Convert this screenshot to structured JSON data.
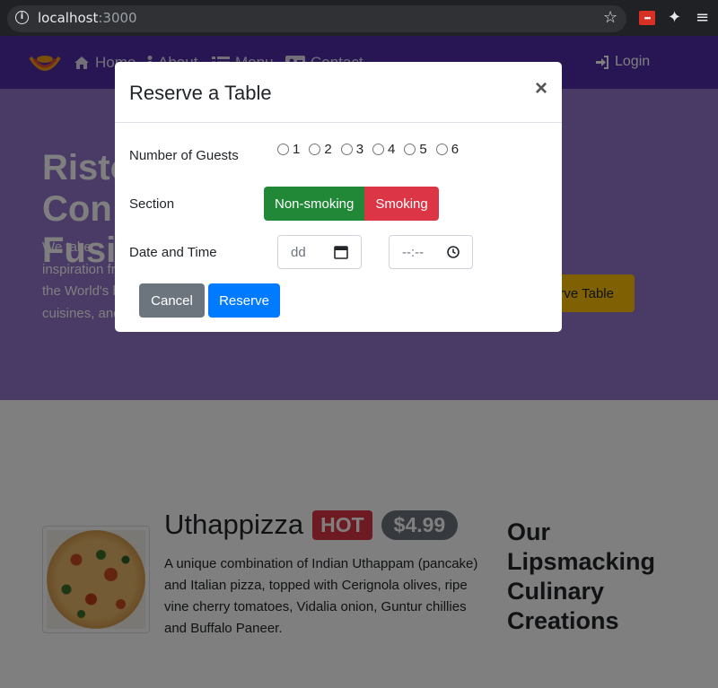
{
  "browser": {
    "url_host": "localhost",
    "url_port": ":3000"
  },
  "navbar": {
    "items": [
      {
        "label": "Home"
      },
      {
        "label": "About"
      },
      {
        "label": "Menu"
      },
      {
        "label": "Contact"
      }
    ],
    "login_label": "Login"
  },
  "jumbotron": {
    "title": "Ristorante Con Fusion",
    "text": "We take inspiration from the World's best cuisines, and create a unique fusion experience. Our lipsmacking creations will tickle your culinary senses!",
    "reserve_label": "Reserve Table"
  },
  "dish": {
    "name": "Uthappizza",
    "label": "HOT",
    "price": "$4.99",
    "description": "A unique combination of Indian Uthappam (pancake) and Italian pizza, topped with Cerignola olives, ripe vine cherry tomatoes, Vidalia onion, Guntur chillies and Buffalo Paneer."
  },
  "side_heading": "Our Lipsmacking Culinary Creations",
  "modal": {
    "title": "Reserve a Table",
    "close": "×",
    "guests_label": "Number of Guests",
    "guest_options": [
      "1",
      "2",
      "3",
      "4",
      "5",
      "6"
    ],
    "section_label": "Section",
    "section_options": [
      "Non-smoking",
      "Smoking"
    ],
    "datetime_label": "Date and Time",
    "date_placeholder": "dd",
    "time_placeholder": "--:--",
    "cancel_label": "Cancel",
    "reserve_label": "Reserve"
  },
  "colors": {
    "navbar": "#512da8",
    "jumbotron": "#9575cd",
    "accent_warning": "#ffc107",
    "success": "#218838",
    "danger": "#dc3545",
    "primary": "#007bff",
    "secondary": "#6c757d"
  }
}
